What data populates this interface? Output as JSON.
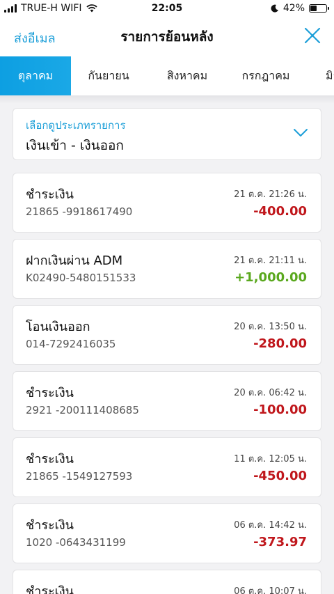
{
  "status_bar": {
    "carrier": "TRUE-H WIFI",
    "time": "22:05",
    "battery": "42%",
    "battery_level": 0.42
  },
  "header": {
    "email_link": "ส่งอีเมล",
    "title": "รายการย้อนหลัง",
    "close_icon": "close-icon"
  },
  "tabs": [
    {
      "label": "ตุลาคม",
      "active": true
    },
    {
      "label": "กันยายน",
      "active": false
    },
    {
      "label": "สิงหาคม",
      "active": false
    },
    {
      "label": "กรกฎาคม",
      "active": false
    },
    {
      "label": "มิถุนายน",
      "active": false
    }
  ],
  "filter": {
    "label": "เลือกดูประเภทรายการ",
    "value": "เงินเข้า - เงินออก"
  },
  "transactions": [
    {
      "title": "ชำระเงิน",
      "ref": "21865 -9918617490",
      "date": "21 ต.ค. 21:26 น.",
      "amount": "-400.00",
      "type": "debit"
    },
    {
      "title": "ฝากเงินผ่าน ADM",
      "ref": "K02490-5480151533",
      "date": "21 ต.ค. 21:11 น.",
      "amount": "+1,000.00",
      "type": "credit"
    },
    {
      "title": "โอนเงินออก",
      "ref": "014-7292416035",
      "date": "20 ต.ค. 13:50 น.",
      "amount": "-280.00",
      "type": "debit"
    },
    {
      "title": "ชำระเงิน",
      "ref": "2921 -200111408685",
      "date": "20 ต.ค. 06:42 น.",
      "amount": "-100.00",
      "type": "debit"
    },
    {
      "title": "ชำระเงิน",
      "ref": "21865 -1549127593",
      "date": "11 ต.ค. 12:05 น.",
      "amount": "-450.00",
      "type": "debit"
    },
    {
      "title": "ชำระเงิน",
      "ref": "1020 -0643431199",
      "date": "06 ต.ค. 14:42 น.",
      "amount": "-373.97",
      "type": "debit"
    },
    {
      "title": "ชำระเงิน",
      "ref": "",
      "date": "06 ต.ค. 10:07 น.",
      "amount": "",
      "type": "debit"
    }
  ],
  "colors": {
    "accent": "#1a9ed8",
    "debit": "#c0171c",
    "credit": "#5aa81e"
  }
}
